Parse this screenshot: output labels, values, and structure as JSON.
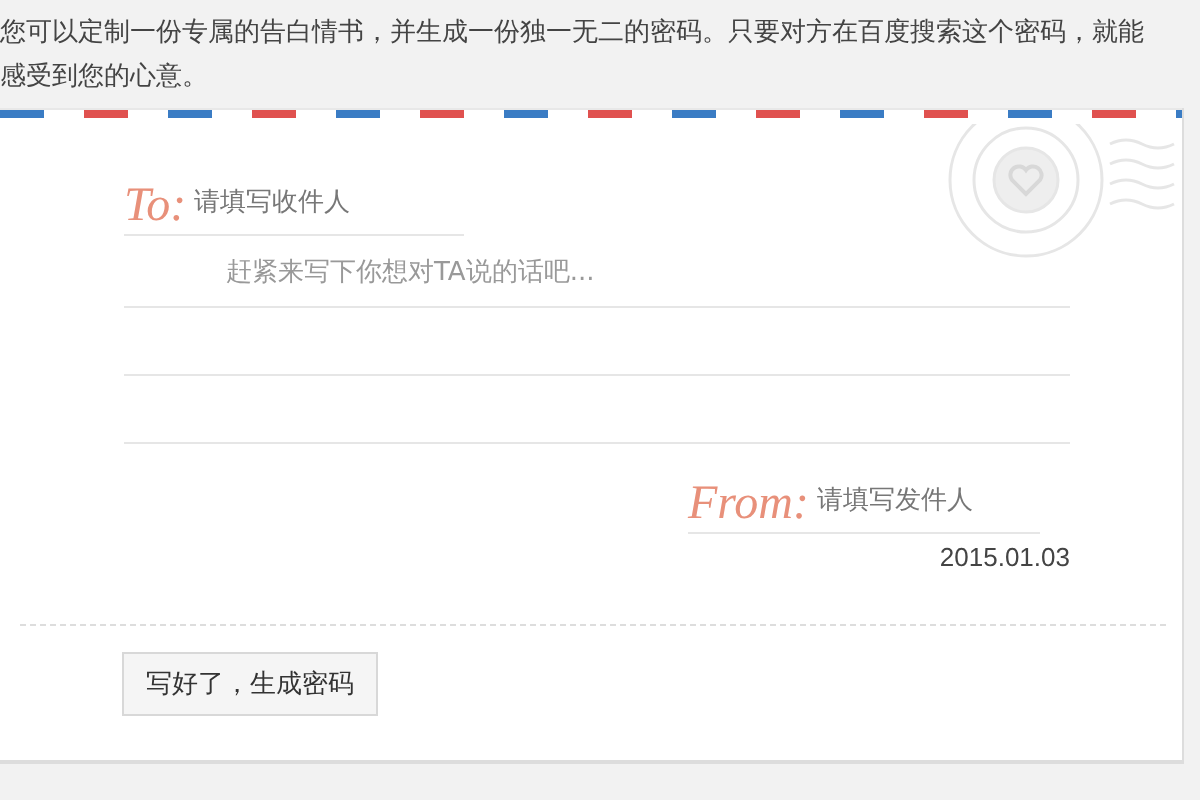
{
  "intro": "您可以定制一份专属的告白情书，并生成一份独一无二的密码。只要对方在百度搜索这个密码，就能感受到您的心意。",
  "letter": {
    "to_label": "To:",
    "recipient": {
      "placeholder": "请填写收件人"
    },
    "message": {
      "placeholder": "赶紧来写下你想对TA说的话吧..."
    },
    "from_label": "From:",
    "sender": {
      "placeholder": "请填写发件人"
    },
    "date": "2015.01.03"
  },
  "buttons": [
    "写好了，生成密码"
  ]
}
